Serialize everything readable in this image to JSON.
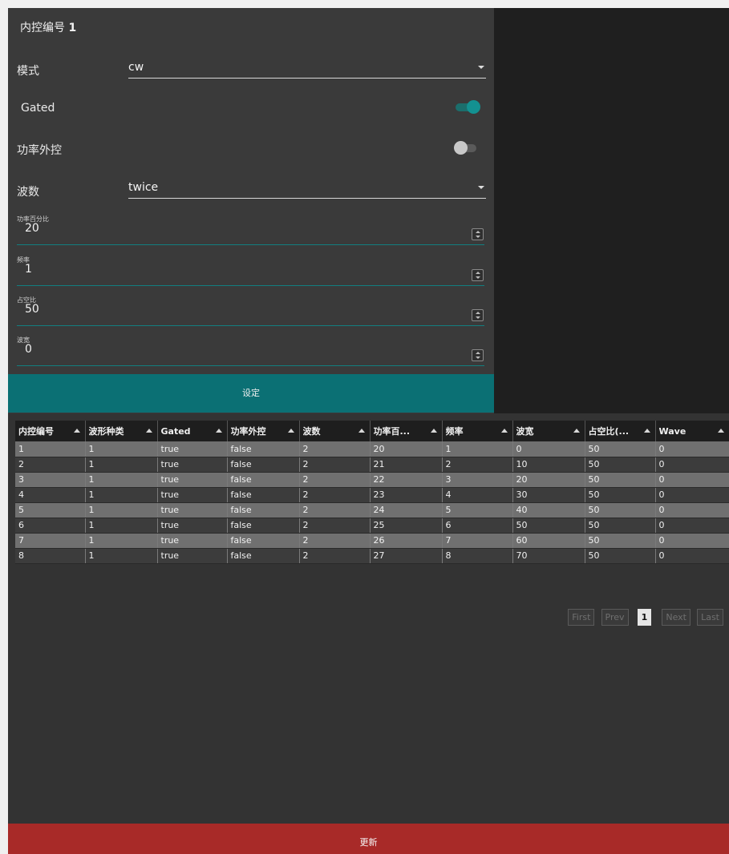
{
  "form": {
    "title_prefix": "内控编号",
    "title_value": "1",
    "mode": {
      "label": "模式",
      "value": "cw"
    },
    "gated": {
      "label": "Gated",
      "on": true
    },
    "power_ext": {
      "label": "功率外控",
      "on": false
    },
    "wave_count": {
      "label": "波数",
      "value": "twice"
    },
    "power_pct": {
      "label": "功率百分比",
      "value": "20"
    },
    "frequency": {
      "label": "频率",
      "value": "1"
    },
    "duty": {
      "label": "占空比",
      "value": "50"
    },
    "wave_width": {
      "label": "波宽",
      "value": "0"
    },
    "set_button": "设定"
  },
  "table": {
    "columns": [
      "内控编号",
      "波形种类",
      "Gated",
      "功率外控",
      "波数",
      "功率百...",
      "频率",
      "波宽",
      "占空比(...",
      "Wave"
    ],
    "rows": [
      [
        "1",
        "1",
        "true",
        "false",
        "2",
        "20",
        "1",
        "0",
        "50",
        "0"
      ],
      [
        "2",
        "1",
        "true",
        "false",
        "2",
        "21",
        "2",
        "10",
        "50",
        "0"
      ],
      [
        "3",
        "1",
        "true",
        "false",
        "2",
        "22",
        "3",
        "20",
        "50",
        "0"
      ],
      [
        "4",
        "1",
        "true",
        "false",
        "2",
        "23",
        "4",
        "30",
        "50",
        "0"
      ],
      [
        "5",
        "1",
        "true",
        "false",
        "2",
        "24",
        "5",
        "40",
        "50",
        "0"
      ],
      [
        "6",
        "1",
        "true",
        "false",
        "2",
        "25",
        "6",
        "50",
        "50",
        "0"
      ],
      [
        "7",
        "1",
        "true",
        "false",
        "2",
        "26",
        "7",
        "60",
        "50",
        "0"
      ],
      [
        "8",
        "1",
        "true",
        "false",
        "2",
        "27",
        "8",
        "70",
        "50",
        "0"
      ]
    ]
  },
  "pager": {
    "first": "First",
    "prev": "Prev",
    "current": "1",
    "next": "Next",
    "last": "Last"
  },
  "update_button": "更新",
  "colors": {
    "accent": "#0b7074",
    "danger": "#a82a28",
    "toggle_on": "#139191"
  }
}
